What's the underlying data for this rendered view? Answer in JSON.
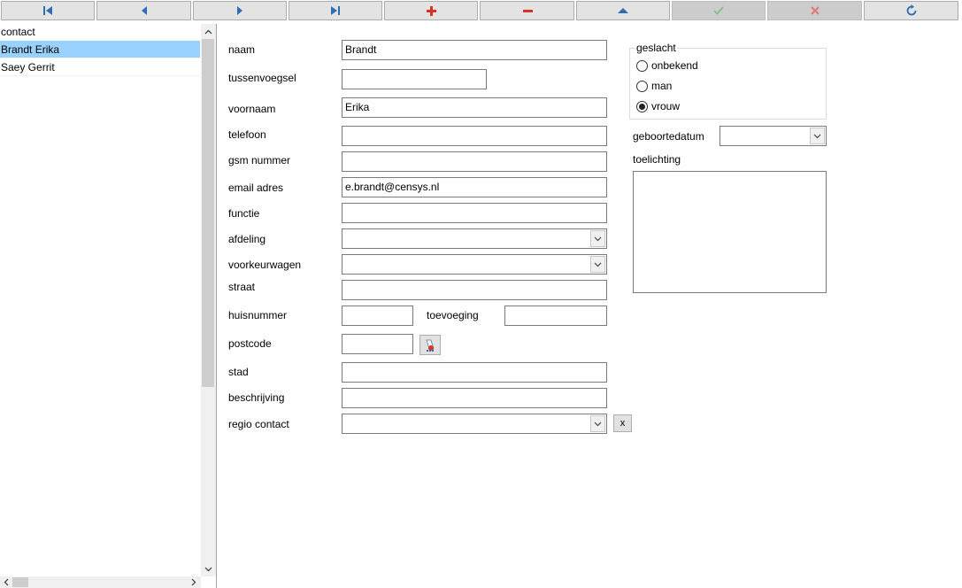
{
  "toolbar": {
    "buttons": [
      {
        "icon": "first-record-icon",
        "color": "#2e6db4",
        "enabled": true
      },
      {
        "icon": "previous-record-icon",
        "color": "#2e6db4",
        "enabled": true
      },
      {
        "icon": "next-record-icon",
        "color": "#2e6db4",
        "enabled": true
      },
      {
        "icon": "last-record-icon",
        "color": "#2e6db4",
        "enabled": true
      },
      {
        "icon": "add-icon",
        "color": "#d9312a",
        "enabled": true
      },
      {
        "icon": "delete-icon",
        "color": "#d9312a",
        "enabled": true
      },
      {
        "icon": "up-icon",
        "color": "#2e6db4",
        "enabled": true
      },
      {
        "icon": "confirm-icon",
        "color": "#7fbf8f",
        "enabled": false
      },
      {
        "icon": "cancel-icon",
        "color": "#e07a76",
        "enabled": false
      },
      {
        "icon": "refresh-icon",
        "color": "#2e6db4",
        "enabled": true
      }
    ]
  },
  "list": {
    "header": "contact",
    "rows": [
      "Brandt  Erika",
      "Saey  Gerrit"
    ],
    "selected_index": 0
  },
  "form": {
    "naam": {
      "label": "naam",
      "value": "Brandt"
    },
    "tussenvoegsel": {
      "label": "tussenvoegsel",
      "value": ""
    },
    "voornaam": {
      "label": "voornaam",
      "value": "Erika"
    },
    "telefoon": {
      "label": "telefoon",
      "value": ""
    },
    "gsm": {
      "label": "gsm nummer",
      "value": ""
    },
    "email": {
      "label": "email adres",
      "value": "e.brandt@censys.nl"
    },
    "functie": {
      "label": "functie",
      "value": ""
    },
    "afdeling": {
      "label": "afdeling",
      "value": ""
    },
    "voorkeurwagen": {
      "label": "voorkeurwagen",
      "value": ""
    },
    "straat": {
      "label": "straat",
      "value": ""
    },
    "huisnummer": {
      "label": "huisnummer",
      "value": ""
    },
    "toevoeging": {
      "label": "toevoeging",
      "value": ""
    },
    "postcode": {
      "label": "postcode",
      "value": ""
    },
    "stad": {
      "label": "stad",
      "value": ""
    },
    "beschrijving": {
      "label": "beschrijving",
      "value": ""
    },
    "regio": {
      "label": "regio contact",
      "value": "",
      "clear_label": "x"
    }
  },
  "geslacht": {
    "title": "geslacht",
    "options": [
      "onbekend",
      "man",
      "vrouw"
    ],
    "selected": "vrouw"
  },
  "geboortedatum": {
    "label": "geboortedatum",
    "value": ""
  },
  "toelichting": {
    "label": "toelichting",
    "value": ""
  }
}
